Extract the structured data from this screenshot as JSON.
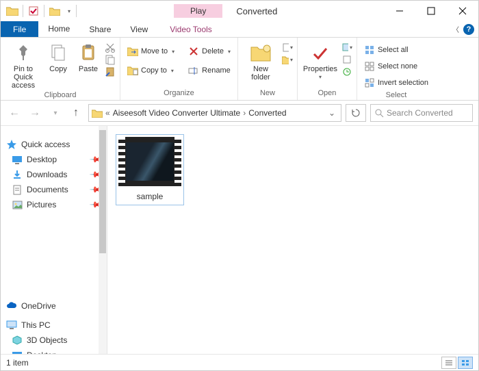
{
  "window": {
    "title": "Converted",
    "tool_context_label": "Play",
    "tool_tab_label": "Video Tools"
  },
  "tabs": {
    "file": "File",
    "home": "Home",
    "share": "Share",
    "view": "View"
  },
  "ribbon": {
    "clipboard": {
      "label": "Clipboard",
      "pin": "Pin to Quick\naccess",
      "copy": "Copy",
      "paste": "Paste"
    },
    "organize": {
      "label": "Organize",
      "move_to": "Move to",
      "copy_to": "Copy to",
      "delete": "Delete",
      "rename": "Rename"
    },
    "new": {
      "label": "New",
      "new_folder": "New\nfolder"
    },
    "open": {
      "label": "Open",
      "properties": "Properties"
    },
    "select": {
      "label": "Select",
      "select_all": "Select all",
      "select_none": "Select none",
      "invert": "Invert selection"
    }
  },
  "address": {
    "parts": [
      "Aiseesoft Video Converter Ultimate",
      "Converted"
    ],
    "prefix": "«"
  },
  "search": {
    "placeholder": "Search Converted"
  },
  "sidebar": {
    "quick_access": "Quick access",
    "items": [
      "Desktop",
      "Downloads",
      "Documents",
      "Pictures"
    ],
    "onedrive": "OneDrive",
    "thispc": "This PC",
    "pc_items": [
      "3D Objects",
      "Desktop"
    ]
  },
  "files": {
    "items": [
      {
        "name": "sample"
      }
    ]
  },
  "status": {
    "count": "1 item"
  }
}
